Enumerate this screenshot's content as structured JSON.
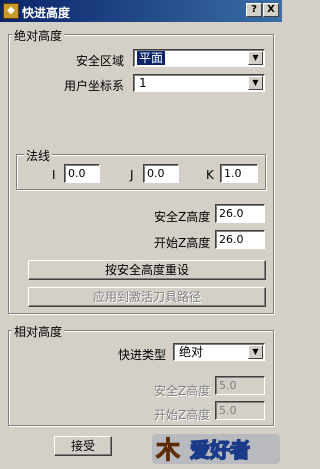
{
  "window": {
    "title": "快进高度",
    "close_glyph": "X",
    "help_glyph": "?"
  },
  "absolute_group": {
    "label": "绝对高度",
    "safe_zone_label": "安全区域",
    "safe_zone_value": "平面",
    "ucs_label": "用户坐标系",
    "ucs_value": "1",
    "normal_group": {
      "label": "法线",
      "i_label": "I",
      "i_value": "0.0",
      "j_label": "J",
      "j_value": "0.0",
      "k_label": "K",
      "k_value": "1.0"
    },
    "safe_z_label": "安全Z高度",
    "safe_z_value": "26.0",
    "start_z_label": "开始Z高度",
    "start_z_value": "26.0",
    "reset_button": "按安全高度重设",
    "apply_button": "应用到激活刀具路径"
  },
  "relative_group": {
    "label": "相对高度",
    "rapid_type_label": "快进类型",
    "rapid_type_value": "绝对",
    "safe_z_label": "安全Z高度",
    "safe_z_value": "5.0",
    "start_z_label": "开始Z高度",
    "start_z_value": "5.0"
  },
  "footer": {
    "accept_button": "接受"
  },
  "watermark": {
    "text": "爱好者",
    "mark": "木"
  },
  "colors": {
    "title_start": "#0a246a",
    "title_end": "#3a6ea5",
    "face": "#d4d0c8",
    "logo_orange": "#f08a00",
    "logo_blue": "#1a3a8a"
  }
}
